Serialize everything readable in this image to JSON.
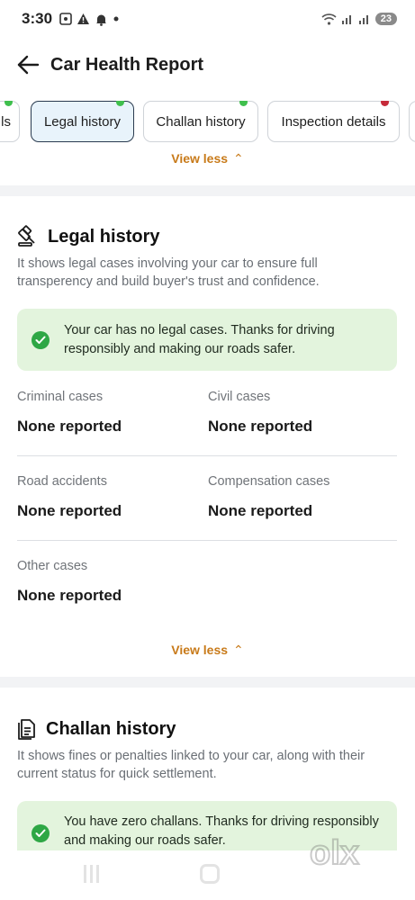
{
  "status_bar": {
    "time": "3:30",
    "icons_left": [
      "screenshot-icon",
      "warning-icon",
      "notification-icon",
      "dot-icon"
    ],
    "battery": "23"
  },
  "header": {
    "title": "Car Health Report"
  },
  "tabs": [
    {
      "label": "ls",
      "dot": "green",
      "active": false
    },
    {
      "label": "Legal history",
      "dot": "green",
      "active": true
    },
    {
      "label": "Challan history",
      "dot": "green",
      "active": false
    },
    {
      "label": "Inspection details",
      "dot": "red",
      "active": false
    }
  ],
  "view_less_label": "View less",
  "legal": {
    "title": "Legal history",
    "description": "It shows legal cases involving your car to ensure full transperency and build buyer's trust and confidence.",
    "success_message": "Your car has no legal cases. Thanks for driving responsibly and making our roads safer.",
    "cases": [
      {
        "label": "Criminal cases",
        "value": "None reported"
      },
      {
        "label": "Civil cases",
        "value": "None reported"
      },
      {
        "label": "Road accidents",
        "value": "None reported"
      },
      {
        "label": "Compensation cases",
        "value": "None reported"
      },
      {
        "label": "Other cases",
        "value": "None reported"
      }
    ],
    "view_less_label": "View less"
  },
  "challan": {
    "title": "Challan history",
    "description": "It shows fines or penalties linked to your car, along with their current status for quick settlement.",
    "success_message": "You have zero challans. Thanks for driving responsibly and making our roads safer."
  },
  "watermark": "olx",
  "colors": {
    "accent_orange": "#c87a19",
    "success_bg": "#e3f4dd",
    "success_check": "#2ea745",
    "active_tab_bg": "#e8f3fb",
    "dot_green": "#3fbf4d",
    "dot_red": "#c62b3a"
  }
}
